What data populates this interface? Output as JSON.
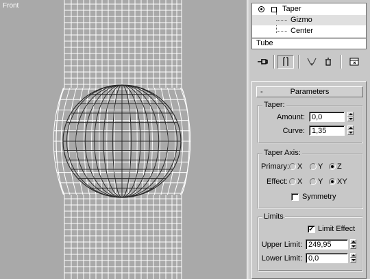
{
  "viewport": {
    "label": "Front"
  },
  "modifier_stack": {
    "items": [
      {
        "label": "Taper"
      },
      {
        "label": "Gizmo"
      },
      {
        "label": "Center"
      },
      {
        "label": "Tube"
      }
    ]
  },
  "toolbar": {
    "buttons": [
      {
        "icon": "pin-stack-icon"
      },
      {
        "icon": "show-end-result-icon"
      },
      {
        "icon": "make-unique-icon"
      },
      {
        "icon": "remove-modifier-icon"
      },
      {
        "icon": "configure-modifier-sets-icon"
      }
    ]
  },
  "parameters": {
    "rollout_toggle": "-",
    "title": "Parameters",
    "taper": {
      "group_label": "Taper:",
      "amount_label": "Amount:",
      "amount_value": "0,0",
      "curve_label": "Curve:",
      "curve_value": "1,35"
    },
    "taper_axis": {
      "group_label": "Taper Axis:",
      "primary_label": "Primary:",
      "primary_options": [
        "X",
        "Y",
        "Z"
      ],
      "primary_selected": "Z",
      "effect_label": "Effect:",
      "effect_options": [
        "X",
        "Y",
        "XY"
      ],
      "effect_selected": "XY",
      "symmetry_label": "Symmetry",
      "symmetry_checked": false
    },
    "limits": {
      "group_label": "Limits",
      "limit_effect_label": "Limit Effect",
      "limit_effect_checked": true,
      "upper_label": "Upper Limit:",
      "upper_value": "249,95",
      "lower_label": "Lower Limit:",
      "lower_value": "0,0"
    }
  },
  "colors": {
    "viewport_bg": "#a9a9a9",
    "wireframe": "#ffffff",
    "gizmo": "#2a2a2a",
    "panel_bg": "#c8c8c8"
  }
}
